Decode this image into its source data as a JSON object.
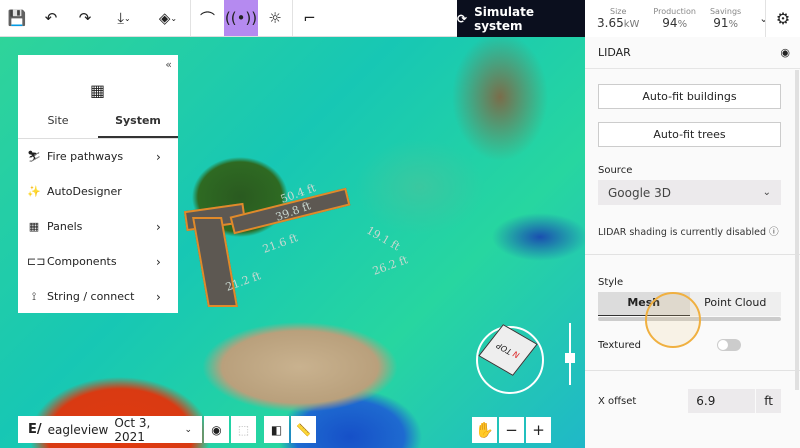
{
  "toolbar": {
    "icons": [
      "save-icon",
      "undo-icon",
      "redo-icon",
      "download-icon",
      "layers-icon",
      "arc-icon",
      "lidar-icon",
      "sun-icon",
      "path-icon"
    ],
    "active": "lidar-icon",
    "accent": "#b58af0",
    "simulate_label": "Simulate system",
    "stats": [
      {
        "label": "Size",
        "value": "3.65",
        "unit": "kW"
      },
      {
        "label": "Production",
        "value": "94",
        "unit": "%"
      },
      {
        "label": "Savings",
        "value": "91",
        "unit": "%"
      }
    ]
  },
  "map": {
    "measurements": [
      "50.4 ft",
      "39.8 ft",
      "21.6 ft",
      "19.1 ft",
      "26.2 ft",
      "21.2 ft"
    ],
    "cube": {
      "top": "TOP",
      "north": "N"
    }
  },
  "left_panel": {
    "tabs": [
      {
        "label": "Site"
      },
      {
        "label": "System",
        "active": true
      }
    ],
    "items": [
      {
        "label": "Fire pathways",
        "icon": "fire-pathway-icon",
        "arrow": true
      },
      {
        "label": "AutoDesigner",
        "icon": "magic-wand-icon",
        "arrow": false
      },
      {
        "label": "Panels",
        "icon": "panels-grid-icon",
        "arrow": true
      },
      {
        "label": "Components",
        "icon": "component-icon",
        "arrow": true
      },
      {
        "label": "String / connect",
        "icon": "string-icon",
        "arrow": true
      }
    ]
  },
  "bottom_bar": {
    "provider": "eagleview",
    "date": "Oct 3, 2021"
  },
  "right_panel": {
    "title": "LIDAR",
    "auto_fit_buildings": "Auto-fit buildings",
    "auto_fit_trees": "Auto-fit trees",
    "source_label": "Source",
    "source_value": "Google 3D",
    "note": "LIDAR shading is currently disabled",
    "style_label": "Style",
    "style_options": [
      "Mesh",
      "Point Cloud"
    ],
    "style_selected": "Mesh",
    "textured_label": "Textured",
    "textured": false,
    "x_offset_label": "X offset",
    "x_offset_value": "6.9",
    "x_offset_unit": "ft"
  }
}
